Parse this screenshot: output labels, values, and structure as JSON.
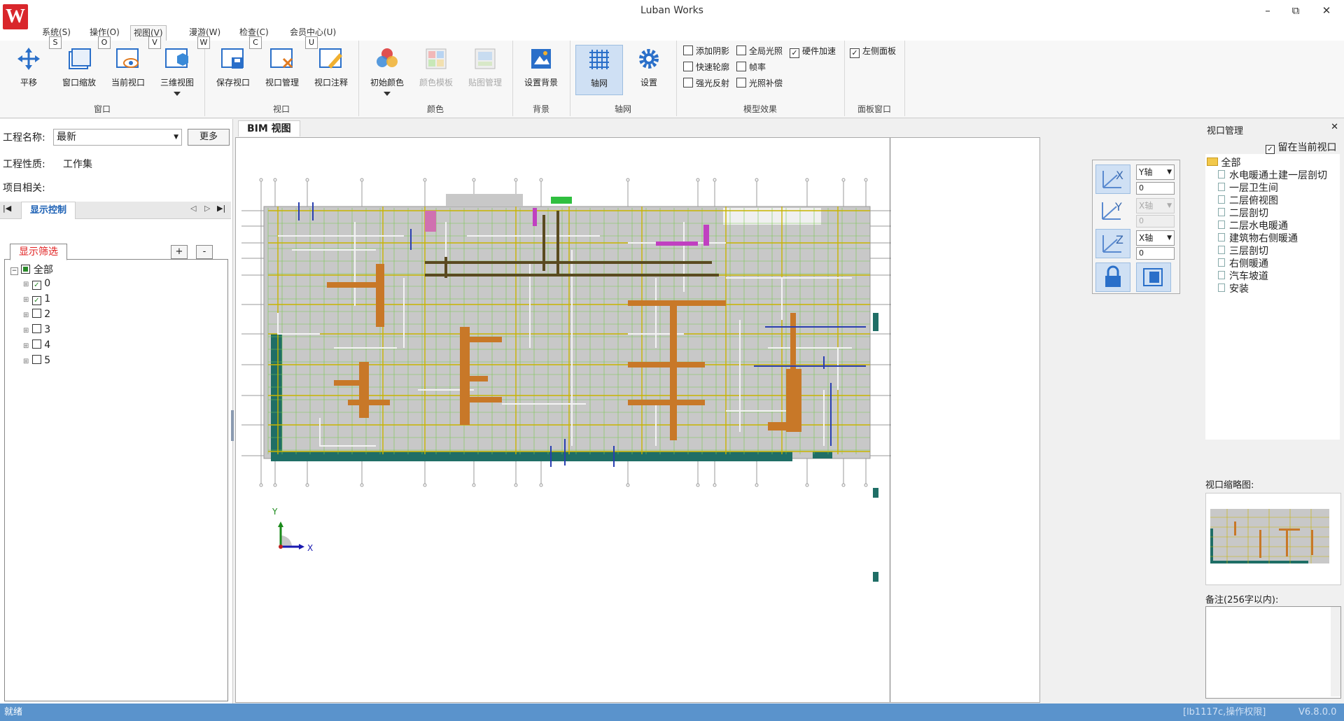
{
  "app": {
    "title": "Luban Works",
    "logo_letter": "W"
  },
  "window_controls": {
    "minimize": "–",
    "maximize": "⧉",
    "close": "✕"
  },
  "menus": [
    {
      "label": "系统(S)",
      "key": "S"
    },
    {
      "label": "操作(O)",
      "key": "O"
    },
    {
      "label": "视图(V)",
      "key": "V"
    },
    {
      "label": "漫游(W)",
      "key": "W"
    },
    {
      "label": "检查(C)",
      "key": "C"
    },
    {
      "label": "会员中心(U)",
      "key": "U"
    }
  ],
  "ribbon": {
    "groups": {
      "window": "窗口",
      "viewport": "视口",
      "color": "颜色",
      "background": "背景",
      "axis": "轴网",
      "effects": "模型效果",
      "panels": "面板窗口"
    },
    "buttons": {
      "pan": "平移",
      "zoom_window": "窗口缩放",
      "current_view": "当前视口",
      "view3d": "三维视图",
      "save_view": "保存视口",
      "view_manage": "视口管理",
      "view_note": "视口注释",
      "init_color": "初始颜色",
      "color_template": "颜色模板",
      "texture_manage": "贴图管理",
      "set_background": "设置背景",
      "axis_grid": "轴网",
      "settings": "设置"
    },
    "checkboxes": {
      "add_shadow": {
        "label": "添加阴影",
        "checked": false
      },
      "global_light": {
        "label": "全局光照",
        "checked": false
      },
      "hw_accel": {
        "label": "硬件加速",
        "checked": true
      },
      "quick_outline": {
        "label": "快速轮廓",
        "checked": false
      },
      "frame_rate": {
        "label": "帧率",
        "checked": false
      },
      "strong_reflect": {
        "label": "强光反射",
        "checked": false
      },
      "light_comp": {
        "label": "光照补偿",
        "checked": false
      },
      "left_panel": {
        "label": "左侧面板",
        "checked": true
      }
    }
  },
  "left_panel": {
    "project_name_label": "工程名称:",
    "project_name_value": "最新",
    "more_button": "更多",
    "project_type_label": "工程性质:",
    "project_type_value": "工作集",
    "project_related_label": "项目相关:",
    "tab_display_control": "显示控制",
    "filter_tab": "显示筛选",
    "plus": "+",
    "minus": "-",
    "tree": [
      {
        "label": "全部",
        "check": "partial"
      },
      {
        "label": "0",
        "check": "checked"
      },
      {
        "label": "1",
        "check": "checked"
      },
      {
        "label": "2",
        "check": "unchecked"
      },
      {
        "label": "3",
        "check": "unchecked"
      },
      {
        "label": "4",
        "check": "unchecked"
      },
      {
        "label": "5",
        "check": "unchecked"
      }
    ]
  },
  "view": {
    "tab": "BIM 视图",
    "axis_x": "X",
    "axis_y": "Y",
    "navcube": {
      "y_axis_select": "Y轴",
      "y_value": "0",
      "x_axis_select_disabled": "X轴",
      "x_value_disabled": "0",
      "x_axis_select": "X轴",
      "x_value": "0"
    },
    "colors": {
      "slab": "#c8c8c8",
      "grid_yellow": "#c8b400",
      "grid_green": "#78c850",
      "duct_orange": "#c87828",
      "wall_teal": "#1f6e66"
    }
  },
  "right_panel": {
    "title": "视口管理",
    "stay_current": {
      "label": "留在当前视口",
      "checked": true
    },
    "tree_root": "全部",
    "views": [
      "水电暖通土建一层剖切",
      "一层卫生间",
      "二层俯视图",
      "二层剖切",
      "二层水电暖通",
      "建筑物右侧暖通",
      "三层剖切",
      "右侧暖通",
      "汽车坡道",
      "安装"
    ],
    "thumbnail_label": "视口缩略图:",
    "note_label": "备注(256字以内):",
    "close_icon": "✕"
  },
  "status": {
    "left": "就绪",
    "permission": "[lb1117c,操作权限]",
    "version": "V6.8.0.0"
  }
}
